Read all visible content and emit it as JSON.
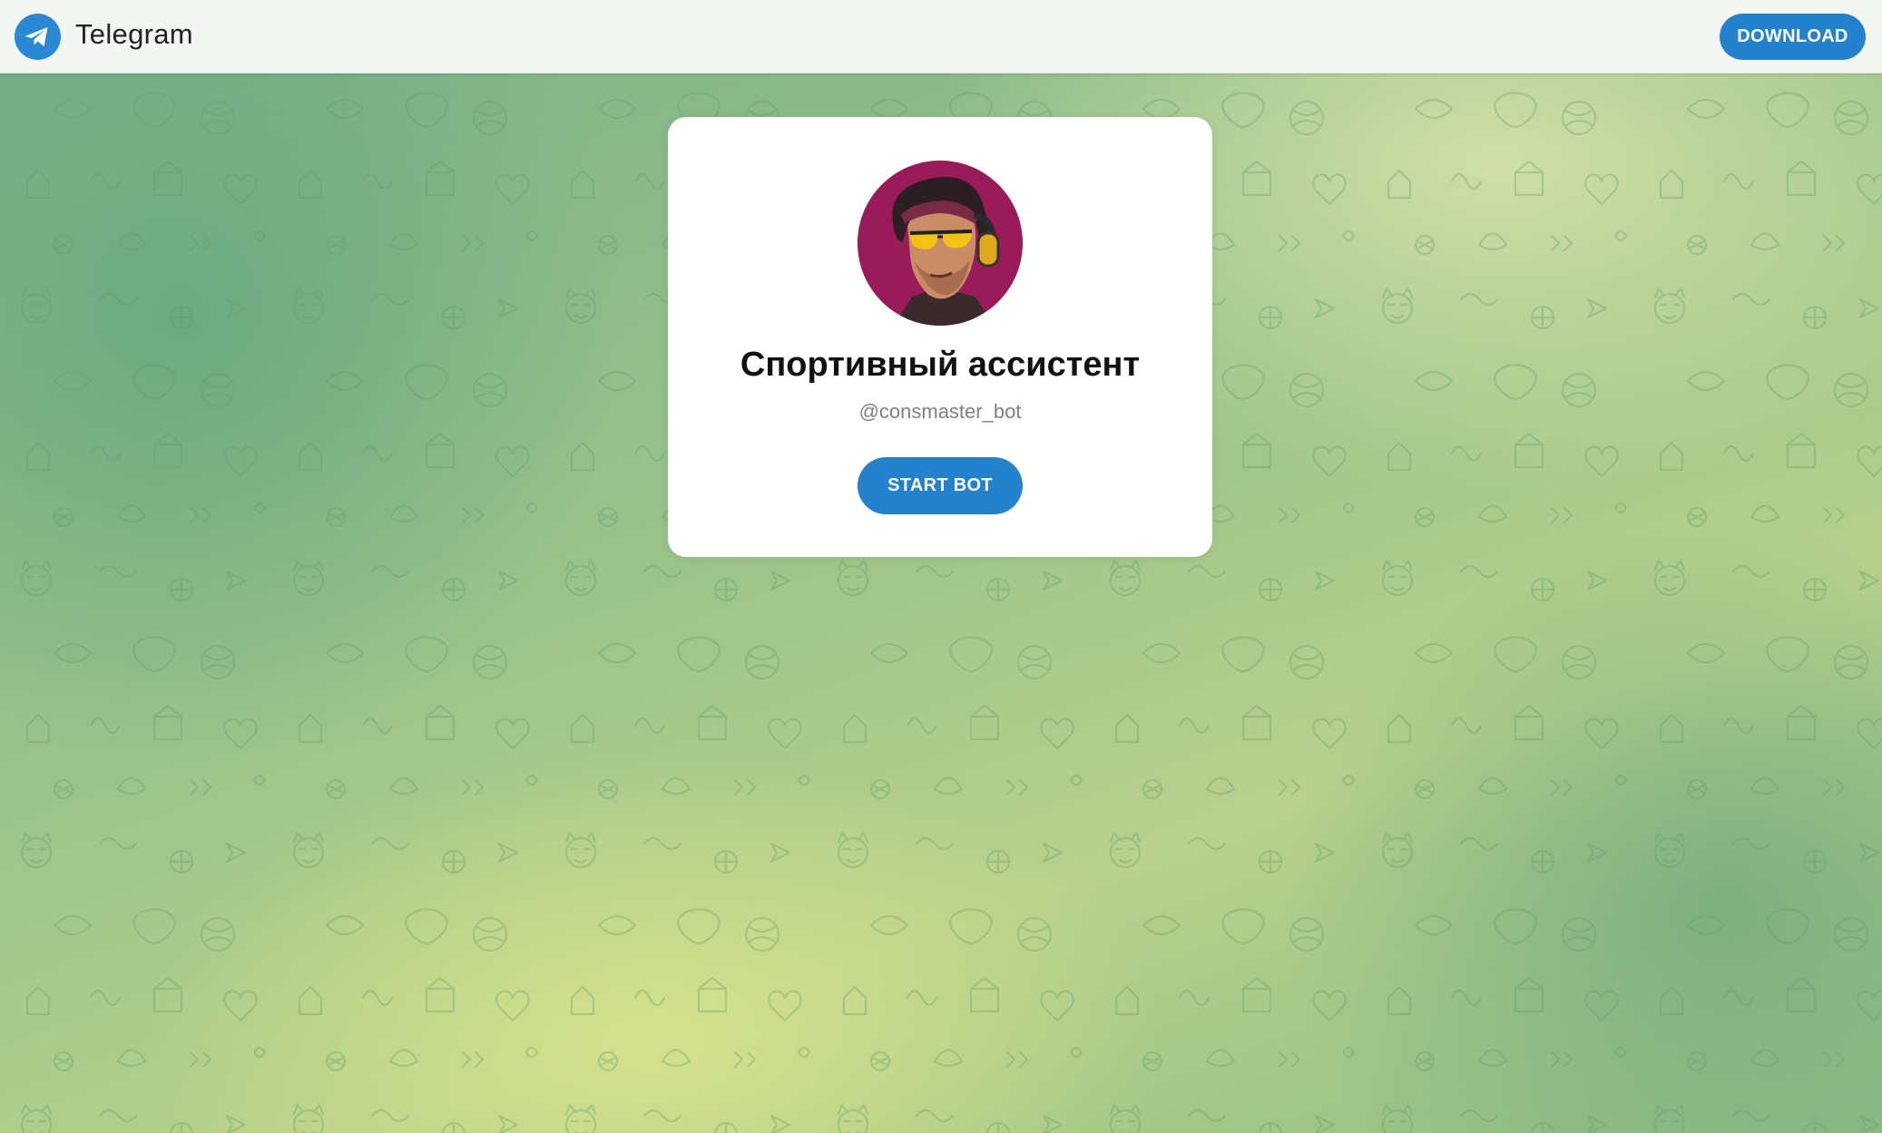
{
  "header": {
    "logo_icon": "telegram-plane-icon",
    "app_name": "Telegram",
    "download_label": "DOWNLOAD"
  },
  "card": {
    "avatar_icon": "bot-avatar",
    "bot_name": "Спортивный ассистент",
    "bot_username": "@consmaster_bot",
    "start_label": "START BOT"
  },
  "colors": {
    "accent": "#2481cc",
    "background_green": "#8fbd84"
  }
}
